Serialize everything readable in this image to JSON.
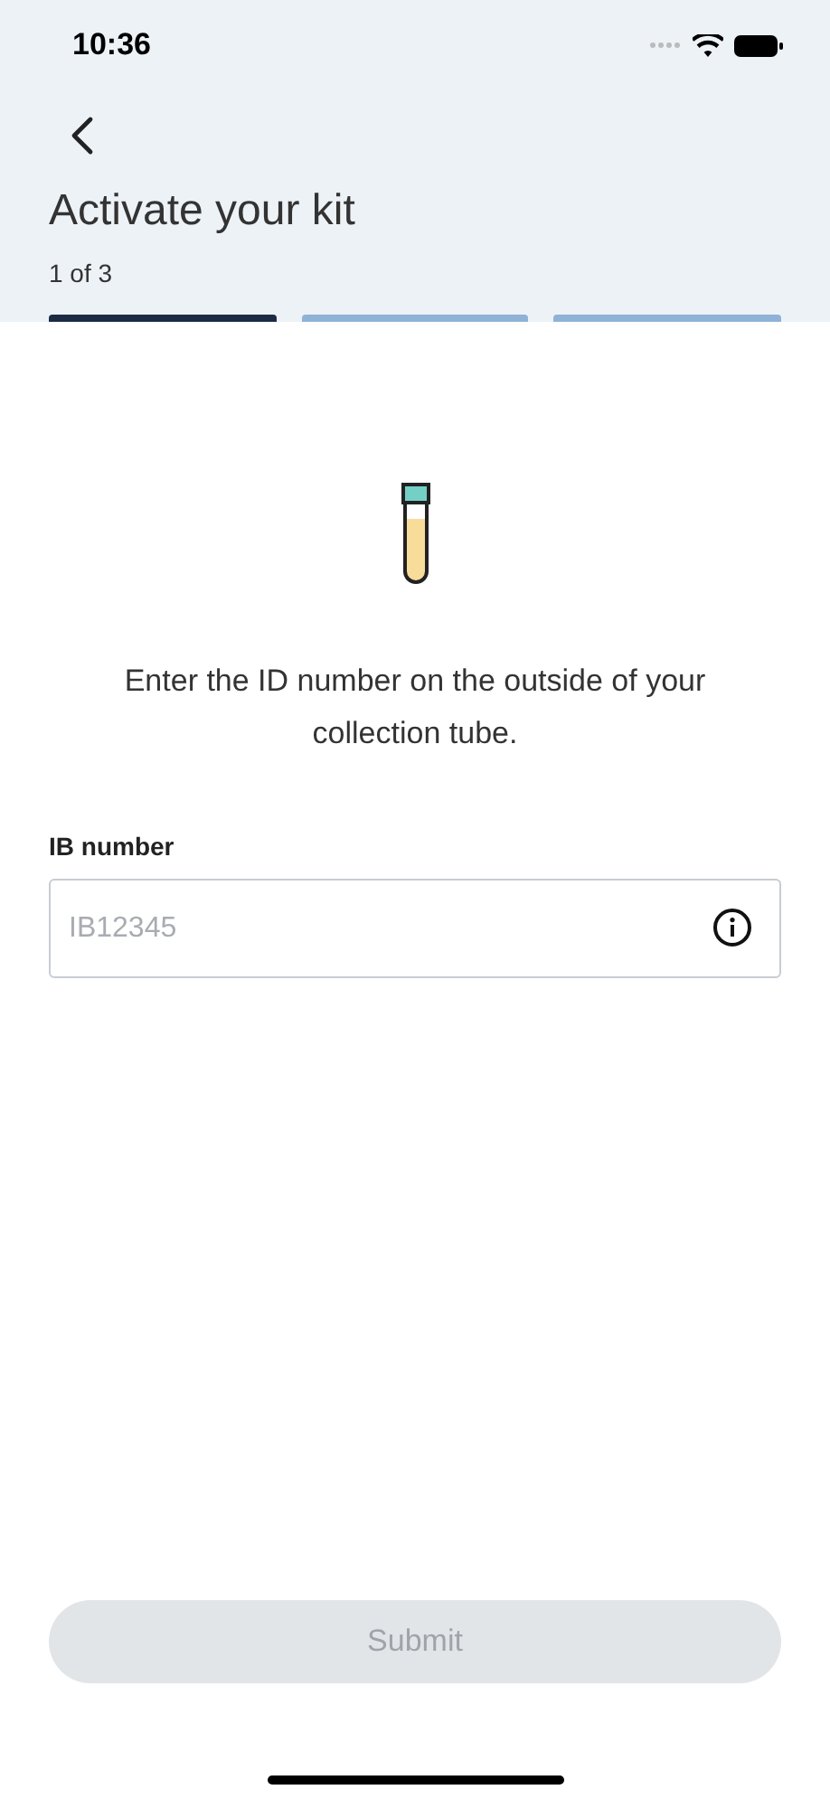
{
  "status_bar": {
    "time": "10:36"
  },
  "header": {
    "title": "Activate your kit",
    "step_label": "1 of 3"
  },
  "steps": [
    {
      "active": true
    },
    {
      "active": false
    },
    {
      "active": false
    }
  ],
  "instruction": "Enter the ID number on the outside of your collection tube.",
  "field": {
    "label": "IB number",
    "placeholder": "IB12345"
  },
  "submit": {
    "label": "Submit",
    "disabled": true
  }
}
